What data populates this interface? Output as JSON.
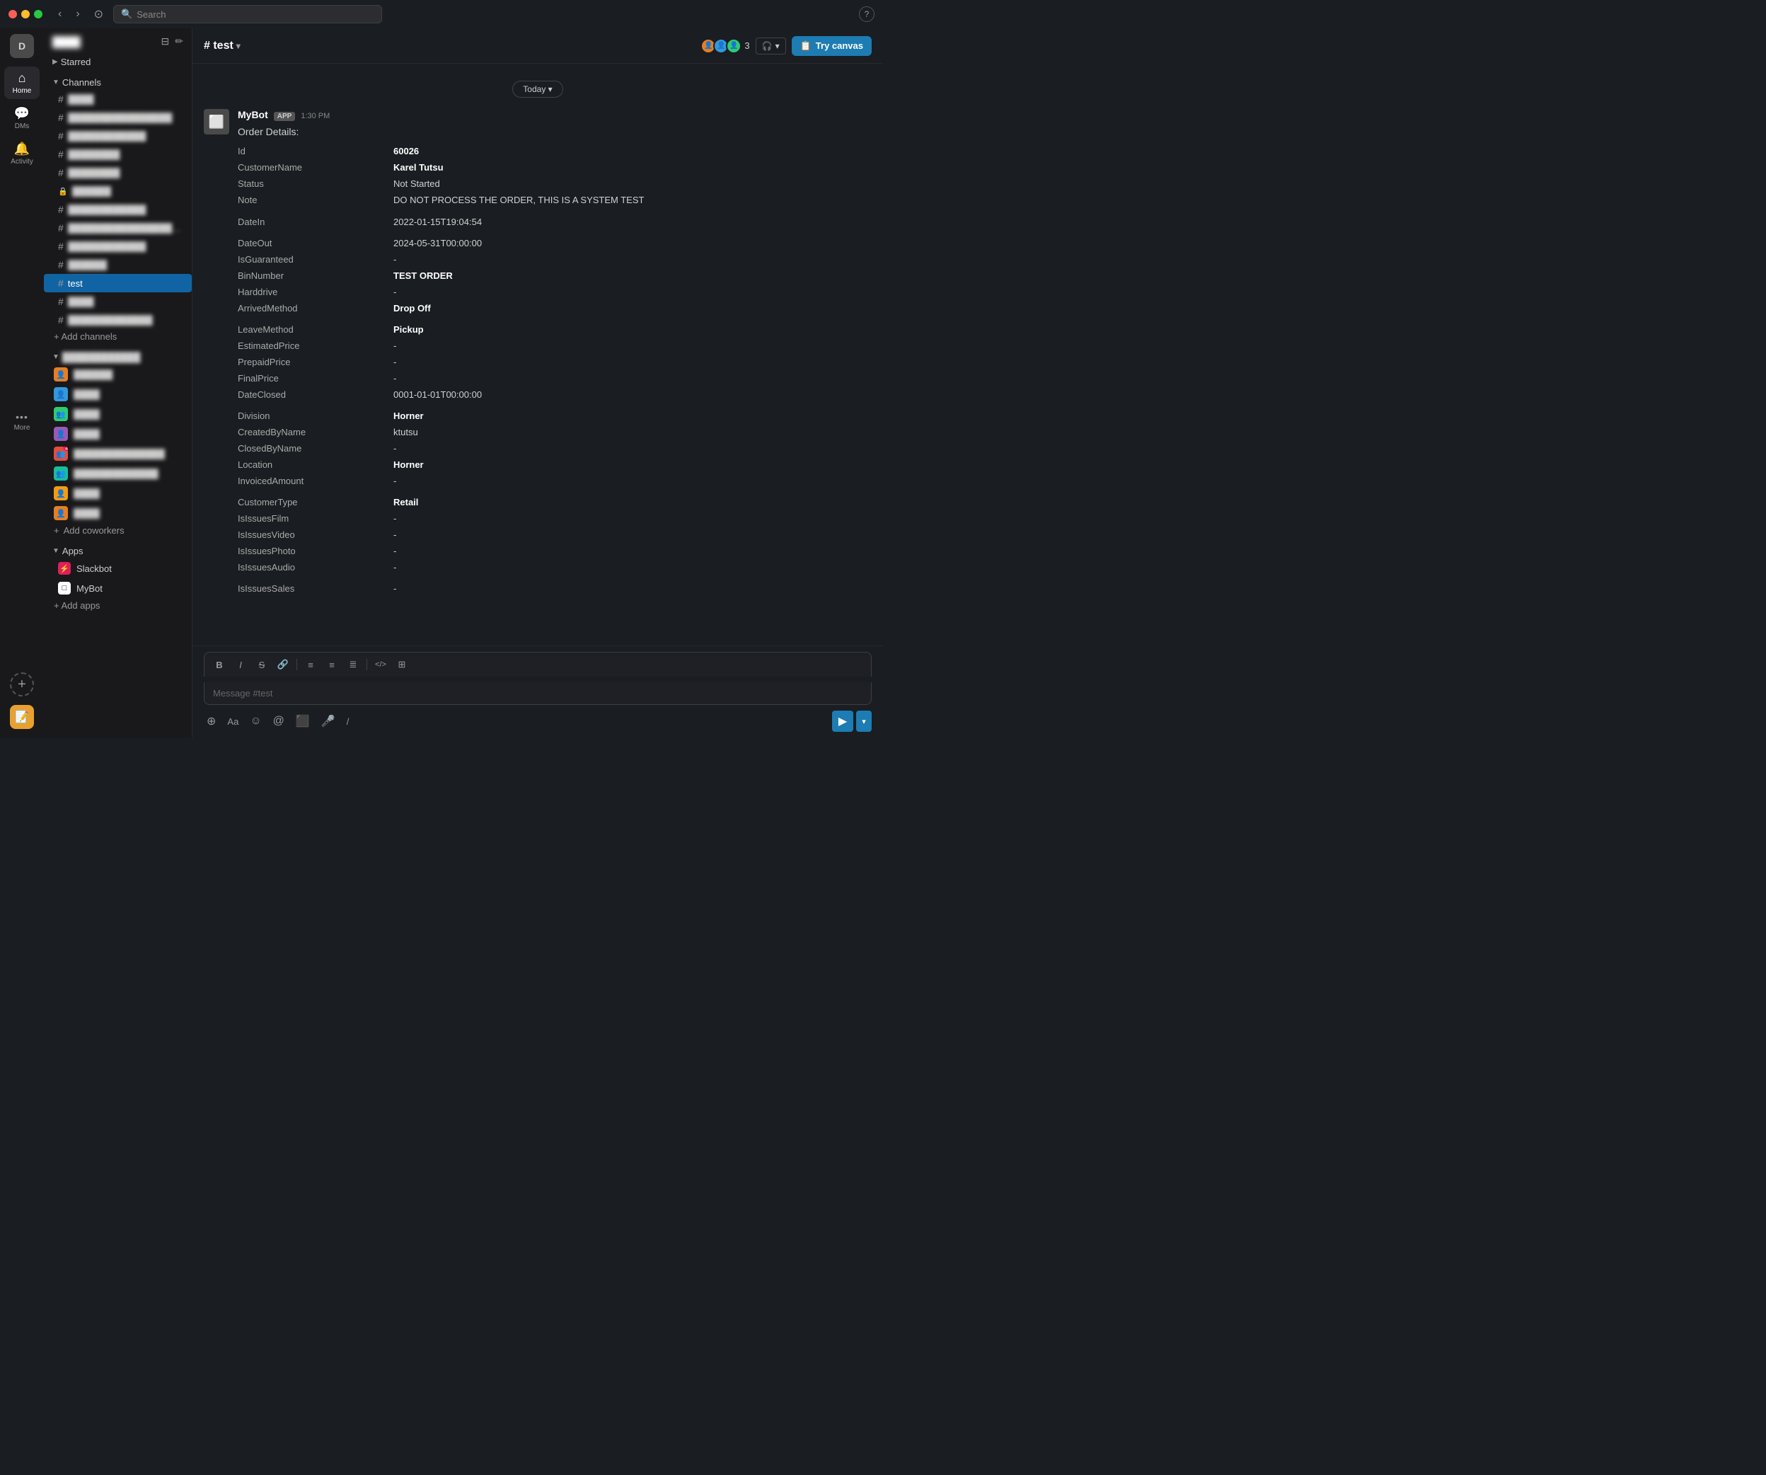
{
  "titlebar": {
    "search_placeholder": "Search",
    "help_label": "?"
  },
  "nav": {
    "workspace_initial": "D",
    "items": [
      {
        "id": "home",
        "label": "Home",
        "icon": "⌂",
        "active": true
      },
      {
        "id": "dms",
        "label": "DMs",
        "icon": "💬",
        "active": false
      },
      {
        "id": "activity",
        "label": "Activity",
        "icon": "🔔",
        "active": false
      },
      {
        "id": "more",
        "label": "More",
        "icon": "•••",
        "active": false
      }
    ]
  },
  "sidebar": {
    "workspace_name": "████",
    "starred_label": "Starred",
    "channels_label": "Channels",
    "channels": [
      {
        "name": "████",
        "type": "hash",
        "active": false,
        "blurred": true
      },
      {
        "name": "████████████████",
        "type": "hash",
        "active": false,
        "blurred": true
      },
      {
        "name": "████████████",
        "type": "hash",
        "active": false,
        "blurred": true
      },
      {
        "name": "████████",
        "type": "hash",
        "active": false,
        "blurred": true
      },
      {
        "name": "████████",
        "type": "hash",
        "active": false,
        "blurred": true
      },
      {
        "name": "██████",
        "type": "lock",
        "active": false,
        "blurred": true
      },
      {
        "name": "████████████",
        "type": "hash",
        "active": false,
        "blurred": true
      },
      {
        "name": "████████████████████",
        "type": "hash",
        "active": false,
        "blurred": true
      },
      {
        "name": "████████████",
        "type": "hash",
        "active": false,
        "blurred": true
      },
      {
        "name": "██████",
        "type": "hash",
        "active": false,
        "blurred": true
      },
      {
        "name": "test",
        "type": "hash",
        "active": true,
        "blurred": false
      },
      {
        "name": "████",
        "type": "hash",
        "active": false,
        "blurred": true
      },
      {
        "name": "█████████████",
        "type": "hash",
        "active": false,
        "blurred": true
      }
    ],
    "add_channel_label": "+ Add channels",
    "dms_section_label": "████████████",
    "dms": [
      {
        "name": "██████",
        "badge": null,
        "color": "#e67e22"
      },
      {
        "name": "████",
        "badge": null,
        "color": "#3498db"
      },
      {
        "name": "████",
        "badge": null,
        "color": "#2ecc71"
      },
      {
        "name": "████",
        "badge": null,
        "color": "#9b59b6"
      },
      {
        "name": "██████████████",
        "badge": "2",
        "color": "#e74c3c"
      },
      {
        "name": "█████████████",
        "badge": null,
        "color": "#1abc9c"
      },
      {
        "name": "████",
        "badge": null,
        "color": "#f39c12"
      },
      {
        "name": "████",
        "badge": null,
        "color": "#e67e22"
      }
    ],
    "add_coworkers_label": "Add coworkers",
    "apps_label": "Apps",
    "apps": [
      {
        "name": "Slackbot",
        "color": "#e01e5a"
      },
      {
        "name": "MyBot",
        "color": "#666"
      }
    ],
    "add_apps_label": "+ Add apps"
  },
  "channel": {
    "name": "# test",
    "member_count": "3",
    "try_canvas_label": "Try canvas"
  },
  "messages": {
    "date_label": "Today",
    "bot": {
      "name": "MyBot",
      "badge": "APP",
      "time": "1:30 PM",
      "intro": "Order Details:",
      "fields": [
        {
          "key": "Id",
          "value": "60026",
          "bold": true
        },
        {
          "key": "CustomerName",
          "value": "Karel Tutsu",
          "bold": true
        },
        {
          "key": "Status",
          "value": "Not Started",
          "bold": false
        },
        {
          "key": "Note",
          "value": "DO NOT PROCESS THE ORDER, THIS IS A SYSTEM TEST",
          "bold": false
        },
        {
          "key": "_spacer",
          "value": ""
        },
        {
          "key": "DateIn",
          "value": "2022-01-15T19:04:54",
          "bold": false
        },
        {
          "key": "_spacer",
          "value": ""
        },
        {
          "key": "DateOut",
          "value": "2024-05-31T00:00:00",
          "bold": false
        },
        {
          "key": "IsGuaranteed",
          "value": "-",
          "bold": false
        },
        {
          "key": "BinNumber",
          "value": "TEST ORDER",
          "bold": true
        },
        {
          "key": "Harddrive",
          "value": "-",
          "bold": false
        },
        {
          "key": "ArrivedMethod",
          "value": "Drop Off",
          "bold": true
        },
        {
          "key": "_spacer",
          "value": ""
        },
        {
          "key": "LeaveMethod",
          "value": "Pickup",
          "bold": true
        },
        {
          "key": "EstimatedPrice",
          "value": "-",
          "bold": false
        },
        {
          "key": "PrepaidPrice",
          "value": "-",
          "bold": false
        },
        {
          "key": "FinalPrice",
          "value": "-",
          "bold": false
        },
        {
          "key": "DateClosed",
          "value": "0001-01-01T00:00:00",
          "bold": false
        },
        {
          "key": "_spacer",
          "value": ""
        },
        {
          "key": "Division",
          "value": "Horner",
          "bold": true
        },
        {
          "key": "CreatedByName",
          "value": "ktutsu",
          "bold": false
        },
        {
          "key": "ClosedByName",
          "value": "-",
          "bold": false
        },
        {
          "key": "Location",
          "value": "Horner",
          "bold": true
        },
        {
          "key": "InvoicedAmount",
          "value": "-",
          "bold": false
        },
        {
          "key": "_spacer",
          "value": ""
        },
        {
          "key": "CustomerType",
          "value": "Retail",
          "bold": true
        },
        {
          "key": "IsIssuesFilm",
          "value": "-",
          "bold": false
        },
        {
          "key": "IsIssuesVideo",
          "value": "-",
          "bold": false
        },
        {
          "key": "IsIssuesPhoto",
          "value": "-",
          "bold": false
        },
        {
          "key": "IsIssuesAudio",
          "value": "-",
          "bold": false
        },
        {
          "key": "_spacer",
          "value": ""
        },
        {
          "key": "IsIssuesSales",
          "value": "-",
          "bold": false
        }
      ]
    }
  },
  "input": {
    "placeholder": "Message #test",
    "formatting": [
      {
        "id": "bold",
        "label": "B",
        "title": "Bold"
      },
      {
        "id": "italic",
        "label": "I",
        "title": "Italic"
      },
      {
        "id": "strike",
        "label": "S̶",
        "title": "Strikethrough"
      },
      {
        "id": "link",
        "label": "🔗",
        "title": "Link"
      },
      {
        "id": "bullet-list",
        "label": "≡",
        "title": "Bulleted list"
      },
      {
        "id": "number-list",
        "label": "≡",
        "title": "Numbered list"
      },
      {
        "id": "ordered-list",
        "label": "≣",
        "title": "Ordered list"
      },
      {
        "id": "code",
        "label": "</>",
        "title": "Code"
      },
      {
        "id": "more-formatting",
        "label": "⊞",
        "title": "More formatting"
      }
    ],
    "actions": [
      {
        "id": "add",
        "icon": "+",
        "title": "Add"
      },
      {
        "id": "text-style",
        "icon": "Aa",
        "title": "Text style"
      },
      {
        "id": "emoji",
        "icon": "☺",
        "title": "Emoji"
      },
      {
        "id": "mention",
        "icon": "@",
        "title": "Mention"
      },
      {
        "id": "media",
        "icon": "⬜",
        "title": "Media"
      },
      {
        "id": "audio",
        "icon": "🎤",
        "title": "Audio"
      },
      {
        "id": "slash",
        "icon": "/",
        "title": "Shortcuts"
      }
    ]
  }
}
